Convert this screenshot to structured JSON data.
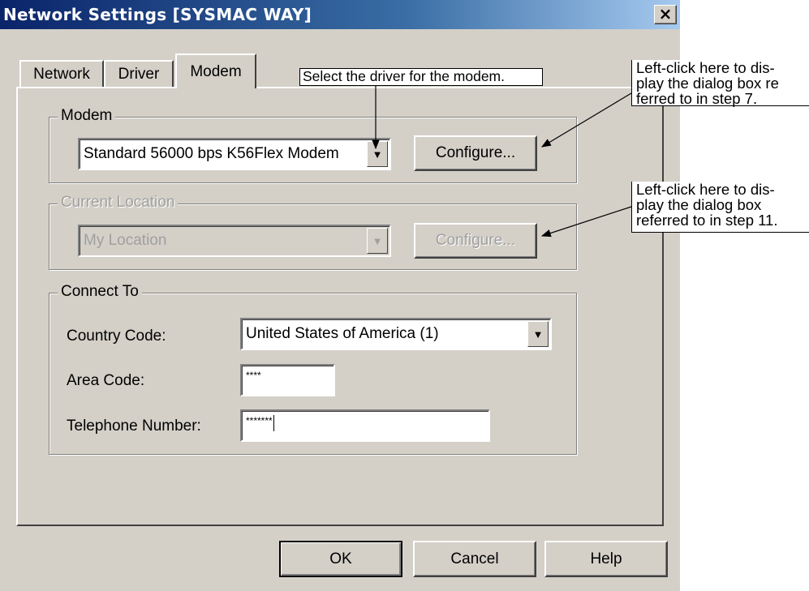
{
  "window": {
    "title": "Network Settings [SYSMAC WAY]",
    "close_glyph": "×"
  },
  "tabs": [
    {
      "label": "Network"
    },
    {
      "label": "Driver"
    },
    {
      "label": "Modem",
      "active": true
    }
  ],
  "modem_group": {
    "legend": "Modem",
    "selected_modem": "Standard 56000 bps K56Flex Modem",
    "configure_label": "Configure..."
  },
  "location_group": {
    "legend": "Current Location",
    "selected_location": "My Location",
    "configure_label": "Configure..."
  },
  "connect_group": {
    "legend": "Connect To",
    "country_label": "Country Code:",
    "country_value": "United States of America (1)",
    "area_label": "Area Code:",
    "area_value": "****",
    "phone_label": "Telephone Number:",
    "phone_value": "*******"
  },
  "buttons": {
    "ok": "OK",
    "cancel": "Cancel",
    "help": "Help"
  },
  "annotations": {
    "select_driver": "Select the driver for the modem.",
    "note_step7": [
      "Left-click here to dis-",
      "play the dialog box re",
      "ferred to in step 7."
    ],
    "note_step11": [
      "Left-click here to dis-",
      "play the dialog box",
      "referred to in step 11."
    ]
  }
}
